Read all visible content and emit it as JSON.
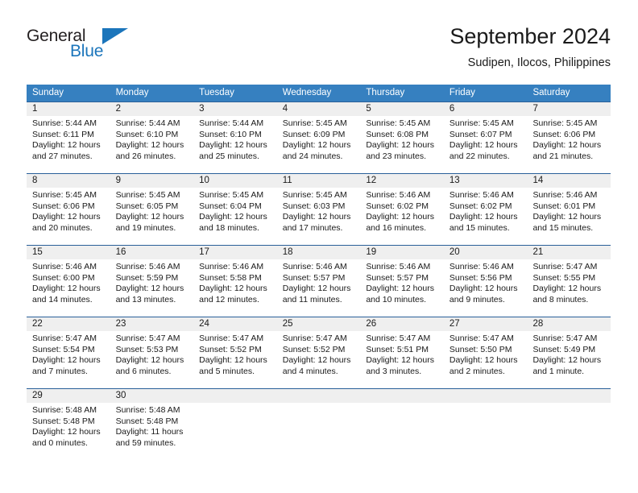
{
  "logo": {
    "word_top": "General",
    "word_bottom": "Blue",
    "accent_color": "#1b75bb",
    "triangle_icon": "triangle-icon"
  },
  "header": {
    "title": "September 2024",
    "subtitle": "Sudipen, Ilocos, Philippines"
  },
  "theme": {
    "header_bg": "#3680c0",
    "row_divider": "#2a6099",
    "day_band_bg": "#efefef",
    "text": "#1a1a1a"
  },
  "weekdays": [
    "Sunday",
    "Monday",
    "Tuesday",
    "Wednesday",
    "Thursday",
    "Friday",
    "Saturday"
  ],
  "weeks": [
    [
      {
        "day": "1",
        "sunrise": "Sunrise: 5:44 AM",
        "sunset": "Sunset: 6:11 PM",
        "daylight": "Daylight: 12 hours and 27 minutes."
      },
      {
        "day": "2",
        "sunrise": "Sunrise: 5:44 AM",
        "sunset": "Sunset: 6:10 PM",
        "daylight": "Daylight: 12 hours and 26 minutes."
      },
      {
        "day": "3",
        "sunrise": "Sunrise: 5:44 AM",
        "sunset": "Sunset: 6:10 PM",
        "daylight": "Daylight: 12 hours and 25 minutes."
      },
      {
        "day": "4",
        "sunrise": "Sunrise: 5:45 AM",
        "sunset": "Sunset: 6:09 PM",
        "daylight": "Daylight: 12 hours and 24 minutes."
      },
      {
        "day": "5",
        "sunrise": "Sunrise: 5:45 AM",
        "sunset": "Sunset: 6:08 PM",
        "daylight": "Daylight: 12 hours and 23 minutes."
      },
      {
        "day": "6",
        "sunrise": "Sunrise: 5:45 AM",
        "sunset": "Sunset: 6:07 PM",
        "daylight": "Daylight: 12 hours and 22 minutes."
      },
      {
        "day": "7",
        "sunrise": "Sunrise: 5:45 AM",
        "sunset": "Sunset: 6:06 PM",
        "daylight": "Daylight: 12 hours and 21 minutes."
      }
    ],
    [
      {
        "day": "8",
        "sunrise": "Sunrise: 5:45 AM",
        "sunset": "Sunset: 6:06 PM",
        "daylight": "Daylight: 12 hours and 20 minutes."
      },
      {
        "day": "9",
        "sunrise": "Sunrise: 5:45 AM",
        "sunset": "Sunset: 6:05 PM",
        "daylight": "Daylight: 12 hours and 19 minutes."
      },
      {
        "day": "10",
        "sunrise": "Sunrise: 5:45 AM",
        "sunset": "Sunset: 6:04 PM",
        "daylight": "Daylight: 12 hours and 18 minutes."
      },
      {
        "day": "11",
        "sunrise": "Sunrise: 5:45 AM",
        "sunset": "Sunset: 6:03 PM",
        "daylight": "Daylight: 12 hours and 17 minutes."
      },
      {
        "day": "12",
        "sunrise": "Sunrise: 5:46 AM",
        "sunset": "Sunset: 6:02 PM",
        "daylight": "Daylight: 12 hours and 16 minutes."
      },
      {
        "day": "13",
        "sunrise": "Sunrise: 5:46 AM",
        "sunset": "Sunset: 6:02 PM",
        "daylight": "Daylight: 12 hours and 15 minutes."
      },
      {
        "day": "14",
        "sunrise": "Sunrise: 5:46 AM",
        "sunset": "Sunset: 6:01 PM",
        "daylight": "Daylight: 12 hours and 15 minutes."
      }
    ],
    [
      {
        "day": "15",
        "sunrise": "Sunrise: 5:46 AM",
        "sunset": "Sunset: 6:00 PM",
        "daylight": "Daylight: 12 hours and 14 minutes."
      },
      {
        "day": "16",
        "sunrise": "Sunrise: 5:46 AM",
        "sunset": "Sunset: 5:59 PM",
        "daylight": "Daylight: 12 hours and 13 minutes."
      },
      {
        "day": "17",
        "sunrise": "Sunrise: 5:46 AM",
        "sunset": "Sunset: 5:58 PM",
        "daylight": "Daylight: 12 hours and 12 minutes."
      },
      {
        "day": "18",
        "sunrise": "Sunrise: 5:46 AM",
        "sunset": "Sunset: 5:57 PM",
        "daylight": "Daylight: 12 hours and 11 minutes."
      },
      {
        "day": "19",
        "sunrise": "Sunrise: 5:46 AM",
        "sunset": "Sunset: 5:57 PM",
        "daylight": "Daylight: 12 hours and 10 minutes."
      },
      {
        "day": "20",
        "sunrise": "Sunrise: 5:46 AM",
        "sunset": "Sunset: 5:56 PM",
        "daylight": "Daylight: 12 hours and 9 minutes."
      },
      {
        "day": "21",
        "sunrise": "Sunrise: 5:47 AM",
        "sunset": "Sunset: 5:55 PM",
        "daylight": "Daylight: 12 hours and 8 minutes."
      }
    ],
    [
      {
        "day": "22",
        "sunrise": "Sunrise: 5:47 AM",
        "sunset": "Sunset: 5:54 PM",
        "daylight": "Daylight: 12 hours and 7 minutes."
      },
      {
        "day": "23",
        "sunrise": "Sunrise: 5:47 AM",
        "sunset": "Sunset: 5:53 PM",
        "daylight": "Daylight: 12 hours and 6 minutes."
      },
      {
        "day": "24",
        "sunrise": "Sunrise: 5:47 AM",
        "sunset": "Sunset: 5:52 PM",
        "daylight": "Daylight: 12 hours and 5 minutes."
      },
      {
        "day": "25",
        "sunrise": "Sunrise: 5:47 AM",
        "sunset": "Sunset: 5:52 PM",
        "daylight": "Daylight: 12 hours and 4 minutes."
      },
      {
        "day": "26",
        "sunrise": "Sunrise: 5:47 AM",
        "sunset": "Sunset: 5:51 PM",
        "daylight": "Daylight: 12 hours and 3 minutes."
      },
      {
        "day": "27",
        "sunrise": "Sunrise: 5:47 AM",
        "sunset": "Sunset: 5:50 PM",
        "daylight": "Daylight: 12 hours and 2 minutes."
      },
      {
        "day": "28",
        "sunrise": "Sunrise: 5:47 AM",
        "sunset": "Sunset: 5:49 PM",
        "daylight": "Daylight: 12 hours and 1 minute."
      }
    ],
    [
      {
        "day": "29",
        "sunrise": "Sunrise: 5:48 AM",
        "sunset": "Sunset: 5:48 PM",
        "daylight": "Daylight: 12 hours and 0 minutes."
      },
      {
        "day": "30",
        "sunrise": "Sunrise: 5:48 AM",
        "sunset": "Sunset: 5:48 PM",
        "daylight": "Daylight: 11 hours and 59 minutes."
      },
      {
        "day": "",
        "sunrise": "",
        "sunset": "",
        "daylight": ""
      },
      {
        "day": "",
        "sunrise": "",
        "sunset": "",
        "daylight": ""
      },
      {
        "day": "",
        "sunrise": "",
        "sunset": "",
        "daylight": ""
      },
      {
        "day": "",
        "sunrise": "",
        "sunset": "",
        "daylight": ""
      },
      {
        "day": "",
        "sunrise": "",
        "sunset": "",
        "daylight": ""
      }
    ]
  ]
}
